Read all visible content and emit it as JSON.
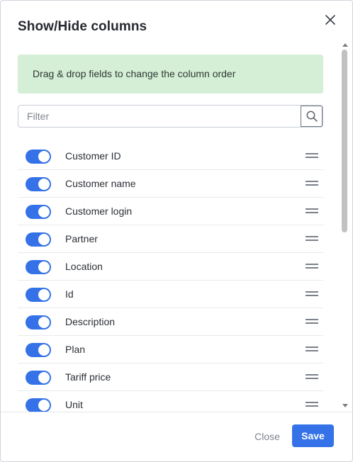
{
  "dialog": {
    "title": "Show/Hide columns",
    "info_message": "Drag & drop fields to change the column order"
  },
  "filter": {
    "placeholder": "Filter",
    "value": ""
  },
  "columns": [
    {
      "label": "Customer ID",
      "enabled": true
    },
    {
      "label": "Customer name",
      "enabled": true
    },
    {
      "label": "Customer login",
      "enabled": true
    },
    {
      "label": "Partner",
      "enabled": true
    },
    {
      "label": "Location",
      "enabled": true
    },
    {
      "label": "Id",
      "enabled": true
    },
    {
      "label": "Description",
      "enabled": true
    },
    {
      "label": "Plan",
      "enabled": true
    },
    {
      "label": "Tariff price",
      "enabled": true
    },
    {
      "label": "Unit",
      "enabled": true
    }
  ],
  "footer": {
    "close_label": "Close",
    "save_label": "Save"
  },
  "colors": {
    "accent": "#3572e8",
    "info_bg": "#d4efd6"
  },
  "icons": {
    "close": "close-icon",
    "search": "search-icon",
    "drag": "drag-handle-icon"
  }
}
